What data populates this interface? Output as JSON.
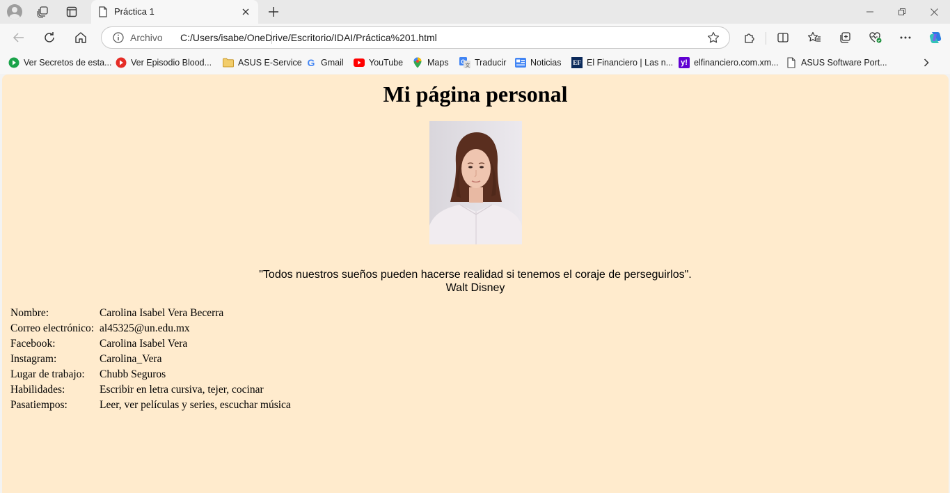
{
  "tab": {
    "title": "Práctica 1"
  },
  "address_bar": {
    "scheme_label": "Archivo",
    "url": "C:/Users/isabe/OneDrive/Escritorio/IDAI/Práctica%201.html"
  },
  "favorites": [
    {
      "label": "Ver Secretos de esta...",
      "icon": "play-circle-icon",
      "color": "#1aa34a"
    },
    {
      "label": "Ver Episodio Blood...",
      "icon": "play-circle-icon",
      "color": "#e52d27"
    },
    {
      "label": "ASUS E-Service",
      "icon": "folder-icon",
      "color": "#e8b84a"
    },
    {
      "label": "Gmail",
      "icon": "google-icon",
      "color": "#4285f4"
    },
    {
      "label": "YouTube",
      "icon": "youtube-icon",
      "color": "#ff0000"
    },
    {
      "label": "Maps",
      "icon": "maps-pin-icon",
      "color": "#34a853"
    },
    {
      "label": "Traducir",
      "icon": "translate-icon",
      "color": "#4285f4"
    },
    {
      "label": "Noticias",
      "icon": "news-icon",
      "color": "#4285f4"
    },
    {
      "label": "El Financiero | Las n...",
      "icon": "ef-icon",
      "color": "#0b2a5b"
    },
    {
      "label": "elfinanciero.com.xm...",
      "icon": "yahoo-icon",
      "color": "#6001d2"
    },
    {
      "label": "ASUS Software Port...",
      "icon": "page-icon",
      "color": "#444444"
    }
  ],
  "page": {
    "heading": "Mi página personal",
    "quote": "\"Todos nuestros sueños pueden hacerse realidad si tenemos el coraje de perseguirlos\".",
    "quote_author": "Walt Disney",
    "rows": [
      {
        "label": "Nombre:",
        "value": "Carolina Isabel Vera Becerra"
      },
      {
        "label": "Correo electrónico:",
        "value": "al45325@un.edu.mx"
      },
      {
        "label": "Facebook:",
        "value": "Carolina Isabel Vera"
      },
      {
        "label": "Instagram:",
        "value": "Carolina_Vera"
      },
      {
        "label": "Lugar de trabajo:",
        "value": "Chubb Seguros"
      },
      {
        "label": "Habilidades:",
        "value": "Escribir en letra cursiva, tejer, cocinar"
      },
      {
        "label": "Pasatiempos:",
        "value": "Leer, ver películas y series, escuchar música"
      }
    ]
  },
  "colors": {
    "page_background": "#ffebcd"
  }
}
